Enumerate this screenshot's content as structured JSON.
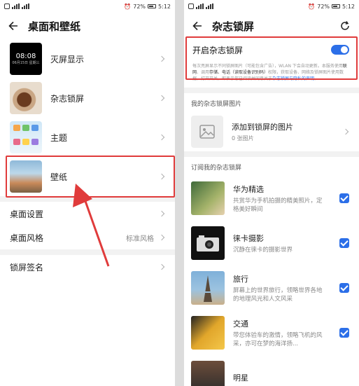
{
  "status_bar": {
    "battery": "72%",
    "time": "5:12"
  },
  "left": {
    "title": "桌面和壁纸",
    "aod_time": "08:08",
    "aod_sub": "06月15日 星期三",
    "items": [
      {
        "label": "灭屏显示"
      },
      {
        "label": "杂志锁屏"
      },
      {
        "label": "主题"
      },
      {
        "label": "壁纸"
      }
    ],
    "settings": [
      {
        "label": "桌面设置",
        "value": ""
      },
      {
        "label": "桌面风格",
        "value": "标准风格"
      }
    ],
    "signature": {
      "label": "锁屏签名"
    }
  },
  "right": {
    "title": "杂志锁屏",
    "toggle_label": "开启杂志锁屏",
    "toggle_on": true,
    "desc_a": "每次亮屏显示不同锁屏图片（可能包含广告），WLAN 下会自动更新。本服务使用",
    "desc_b": "联网",
    "desc_c": "、调用",
    "desc_d": "存储、电话（读取设备识别码）",
    "desc_e": "权限，获取设备、网络及锁屏图片使用数据。打开开关，即表示您已阅读并同意关于",
    "desc_f": "杂志锁屏与隐私的声明",
    "desc_g": "。",
    "my_section": "我的杂志锁屏图片",
    "add_main": "添加到锁屏的图片",
    "add_sub": "0 张图片",
    "sub_section": "订阅我的杂志锁屏",
    "subs": [
      {
        "name": "华为精选",
        "desc": "共赏华为手机拍摄的精美照片，定格美好瞬间"
      },
      {
        "name": "徕卡摄影",
        "desc": "沉静在徕卡的摄影世界"
      },
      {
        "name": "旅行",
        "desc": "屏幕上的世界旅行，领略世界各地的地理风光和人文风采"
      },
      {
        "name": "交通",
        "desc": "带您体验车的激情，领略飞机的风采，亦可在梦的海洋扬..."
      },
      {
        "name": "明星",
        "desc": ""
      }
    ]
  },
  "colors": {
    "accent": "#2c6fe8",
    "highlight": "#e03b3b"
  }
}
